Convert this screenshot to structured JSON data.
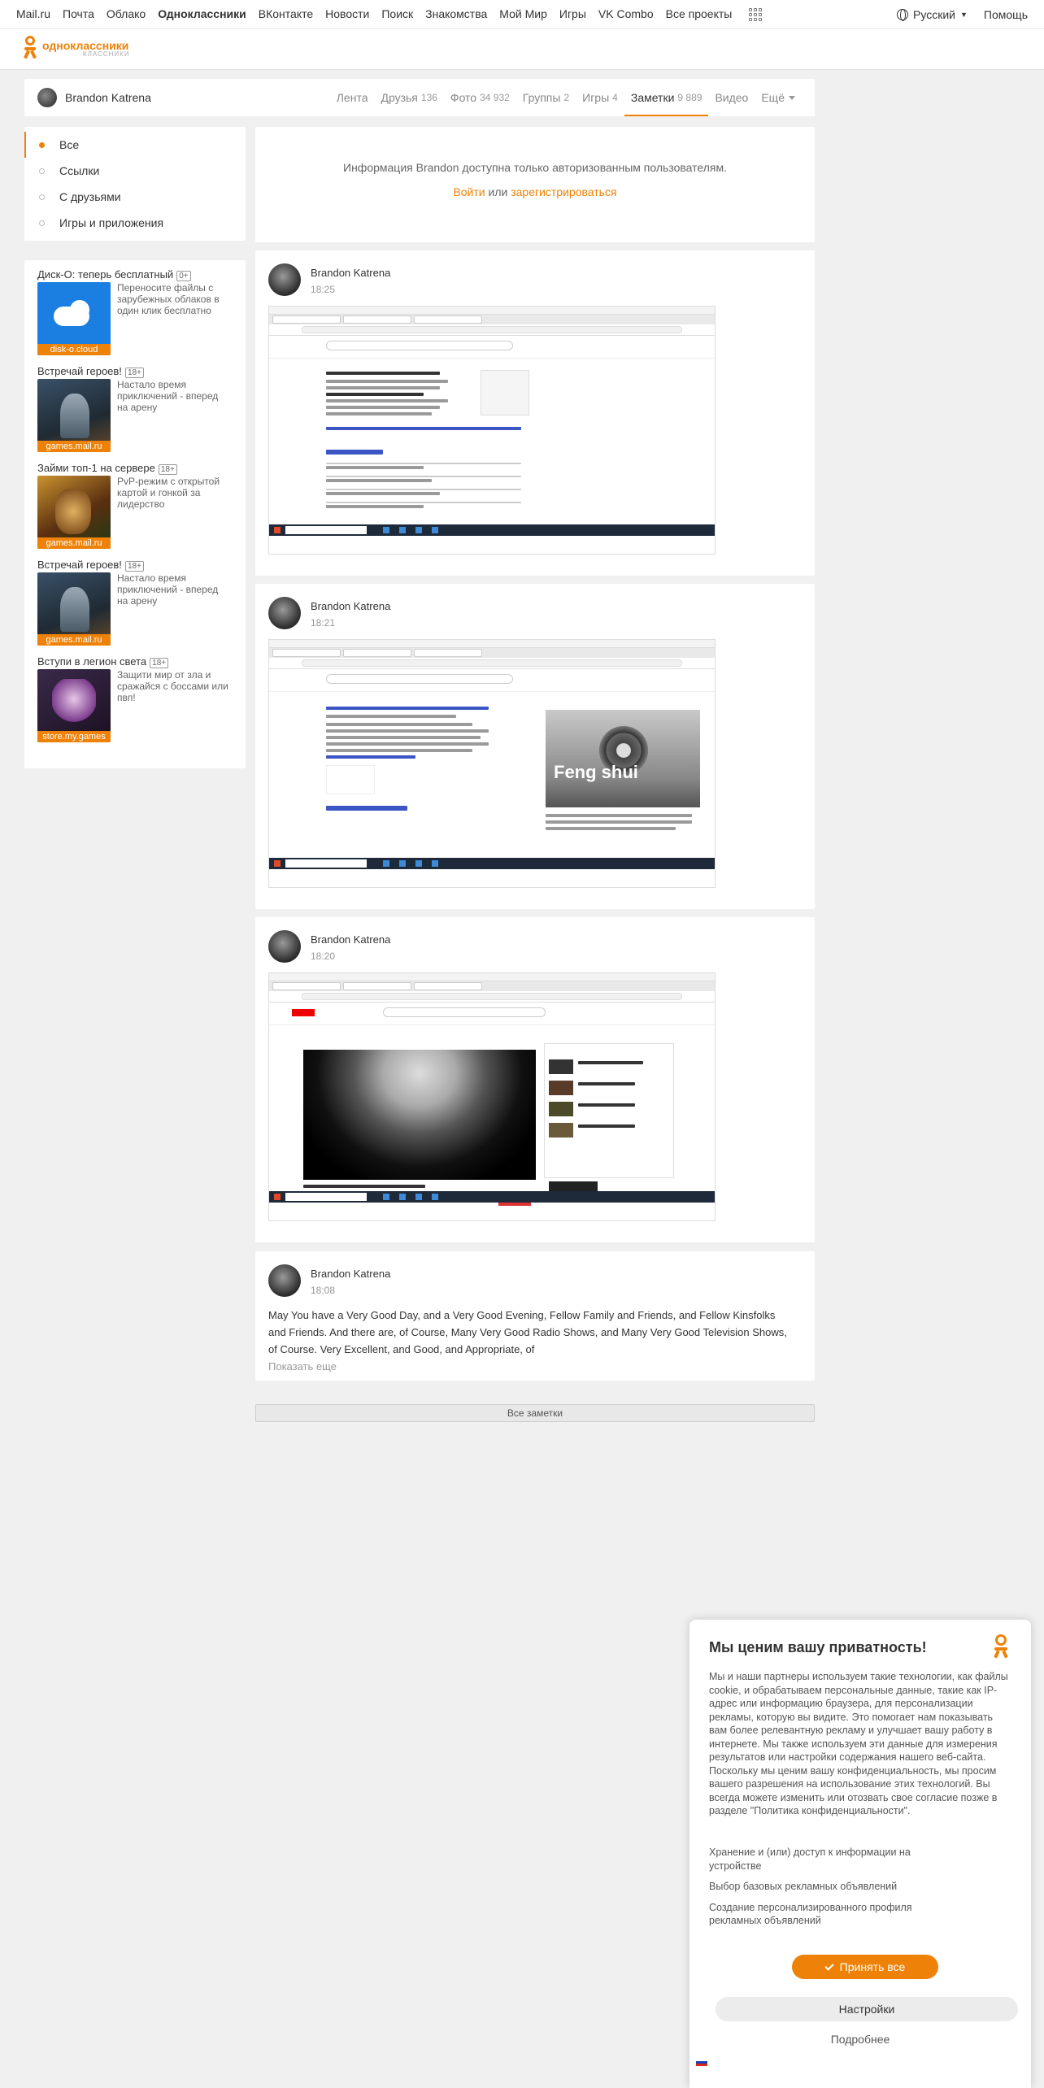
{
  "portal": {
    "links": [
      "Mail.ru",
      "Почта",
      "Облако",
      "Одноклассники",
      "ВКонтакте",
      "Новости",
      "Поиск",
      "Знакомства",
      "Мой Мир",
      "Игры",
      "VK Combo",
      "Все проекты"
    ],
    "language": "Русский",
    "help": "Помощь"
  },
  "logo": {
    "name": "одноклассники",
    "sub": "КЛАССНИКИ"
  },
  "profile": {
    "name": "Brandon Katrena",
    "tabs": [
      {
        "label": "Лента",
        "count": ""
      },
      {
        "label": "Друзья",
        "count": "136"
      },
      {
        "label": "Фото",
        "count": "34 932"
      },
      {
        "label": "Группы",
        "count": "2"
      },
      {
        "label": "Игры",
        "count": "4"
      },
      {
        "label": "Заметки",
        "count": "9 889"
      },
      {
        "label": "Видео",
        "count": ""
      },
      {
        "label": "Ещё",
        "count": ""
      }
    ]
  },
  "menu": [
    "Все",
    "Ссылки",
    "С друзьями",
    "Игры и приложения"
  ],
  "ads": [
    {
      "title": "Диск-О: теперь бесплатный",
      "age": "0+",
      "desc": "Переносите файлы с зарубежных облаков в один клик бесплатно",
      "source": "disk-o.cloud"
    },
    {
      "title": "Встречай героев!",
      "age": "18+",
      "desc": "Настало время приключений - вперед на арену",
      "source": "games.mail.ru"
    },
    {
      "title": "Займи топ-1 на сервере",
      "age": "18+",
      "desc": "PvP-режим с открытой картой и гонкой за лидерство",
      "source": "games.mail.ru"
    },
    {
      "title": "Встречай героев!",
      "age": "18+",
      "desc": "Настало время приключений - вперед на арену",
      "source": "games.mail.ru"
    },
    {
      "title": "Вступи в легион света",
      "age": "18+",
      "desc": "Защити мир от зла и сражайся с боссами или пвп!",
      "source": "store.my.games"
    }
  ],
  "info": {
    "text": "Информация Brandon доступна только авторизованным пользователям.",
    "login": "Войти",
    "or": "или",
    "register": "зарегистрироваться"
  },
  "posts": [
    {
      "author": "Brandon Katrena",
      "time": "18:25"
    },
    {
      "author": "Brandon Katrena",
      "time": "18:21",
      "image_text": "Feng shui"
    },
    {
      "author": "Brandon Katrena",
      "time": "18:20"
    },
    {
      "author": "Brandon Katrena",
      "time": "18:08",
      "text": "May You have a Very Good Day, and a Very Good Evening, Fellow Family and Friends, and Fellow Kinsfolks and Friends.  And there are, of Course, Many Very Good Radio Shows, and Many Very Good Television Shows, of Course.  Very Excellent, and Good, and Appropriate, of",
      "more": "Показать еще"
    }
  ],
  "all_notes": "Все заметки",
  "privacy": {
    "title": "Мы ценим вашу приватность!",
    "text": "Мы и наши партнеры используем такие технологии, как файлы cookie, и обрабатываем персональные данные, такие как IP-адрес или информацию браузера, для персонализации рекламы, которую вы видите. Это помогает нам показывать вам более релевантную рекламу и улучшает вашу работу в интернете. Мы также используем эти данные для измерения результатов или настройки содержания нашего веб-сайта. Поскольку мы ценим вашу конфиденциальность, мы просим вашего разрешения на использование этих технологий. Вы всегда можете изменить или отозвать свое согласие позже в разделе \"Политика конфиденциальности\".",
    "items": [
      "Хранение и (или) доступ к информации на устройстве",
      "Выбор базовых рекламных объявлений",
      "Создание персонализированного профиля рекламных объявлений"
    ],
    "accept": "Принять все",
    "settings": "Настройки",
    "more": "Подробнее"
  },
  "colors": {
    "accent": "#ee8208"
  }
}
